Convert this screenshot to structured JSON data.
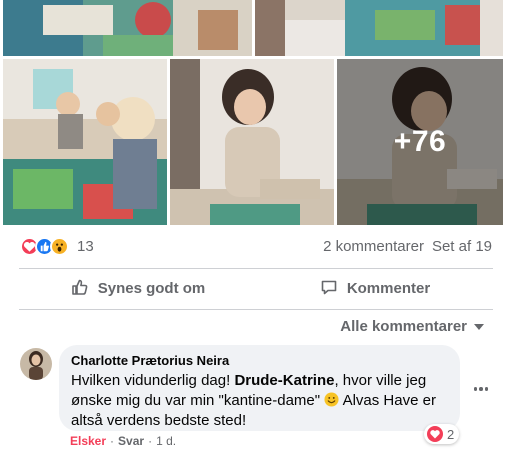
{
  "photos": {
    "more_count": "+76"
  },
  "reactions": {
    "icons": [
      "heart-icon",
      "like-icon",
      "wow-icon"
    ],
    "count": "13",
    "comments": "2 kommentarer",
    "seen_by": "Set af 19"
  },
  "actions": {
    "like_label": "Synes godt om",
    "comment_label": "Kommenter"
  },
  "comments_sort": {
    "label": "Alle kommentarer"
  },
  "comment": {
    "author": "Charlotte Prætorius Neira",
    "text_before": "Hvilken vidunderlig dag! ",
    "mention": "Drude-Katrine",
    "text_middle": ", hvor ville jeg ønske mig du var min \"kantine-dame\" ",
    "text_after": " Alvas Have er altså verdens bedste sted!",
    "emoji": "smile-emoji",
    "reaction_count": "2",
    "liked_label": "Elsker",
    "sep1": "·",
    "reply_label": "Svar",
    "sep2": "·",
    "time": "1 d."
  },
  "colors": {
    "love": "#f33e58",
    "like": "#1877f2",
    "wow": "#f7b125",
    "muted": "#65676b",
    "bubble": "#f0f2f5"
  }
}
